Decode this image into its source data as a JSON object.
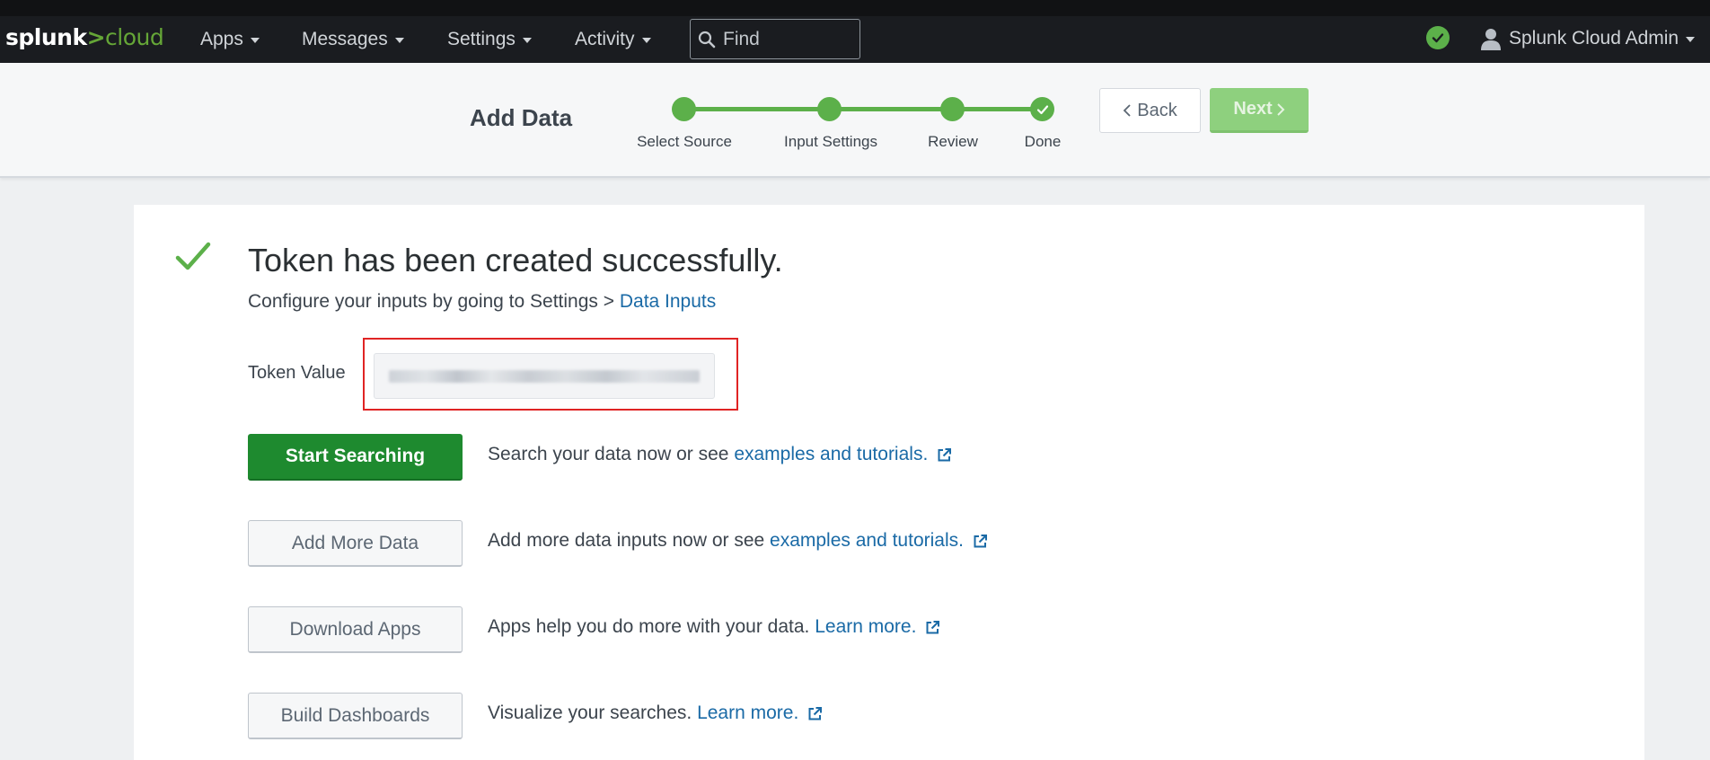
{
  "topbar": {
    "logo_brand": "splunk",
    "logo_gt": ">",
    "logo_cloud": "cloud",
    "menus": [
      "Apps",
      "Messages",
      "Settings",
      "Activity"
    ],
    "find_placeholder": "Find",
    "status_icon": "check-circle",
    "status_color": "#5cb04a",
    "user_label": "Splunk Cloud Admin"
  },
  "wizard": {
    "title": "Add Data",
    "steps": [
      "Select Source",
      "Input Settings",
      "Review",
      "Done"
    ],
    "back_label": "Back",
    "next_label": "Next",
    "accent_color": "#5cb04a"
  },
  "content": {
    "title": "Token has been created successfully.",
    "subtitle_prefix": "Configure your inputs by going to Settings > ",
    "subtitle_link": "Data Inputs",
    "token_label": "Token Value",
    "actions": [
      {
        "button": "Start Searching",
        "text": "Search your data now or see ",
        "link": "examples and tutorials."
      },
      {
        "button": "Add More Data",
        "text": "Add more data inputs now or see ",
        "link": "examples and tutorials."
      },
      {
        "button": "Download Apps",
        "text": "Apps help you do more with your data. ",
        "link": "Learn more."
      },
      {
        "button": "Build Dashboards",
        "text": "Visualize your searches. ",
        "link": "Learn more."
      }
    ],
    "primary_color": "#1e8a2f",
    "link_color": "#1a6aa6"
  }
}
